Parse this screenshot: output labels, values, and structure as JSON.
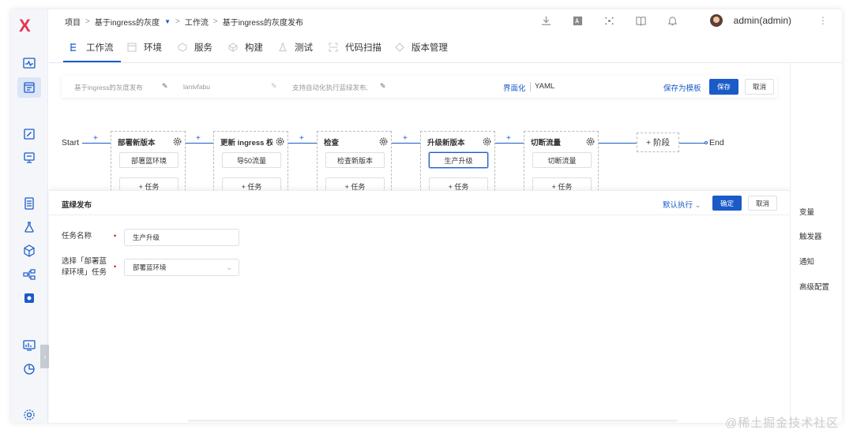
{
  "app": {
    "logo": "X"
  },
  "breadcrumb": [
    "项目",
    "基于ingress的灰度",
    "工作流",
    "基于ingress的灰度发布"
  ],
  "user": {
    "name": "admin(admin)"
  },
  "topbar_icons": [
    "download-icon",
    "translate-icon",
    "plugin-icon",
    "book-icon",
    "bell-icon"
  ],
  "tabs": [
    {
      "label": "工作流",
      "icon": "workflow-icon"
    },
    {
      "label": "环境",
      "icon": "env-icon"
    },
    {
      "label": "服务",
      "icon": "service-icon"
    },
    {
      "label": "构建",
      "icon": "build-icon"
    },
    {
      "label": "测试",
      "icon": "test-icon"
    },
    {
      "label": "代码扫描",
      "icon": "scan-icon"
    },
    {
      "label": "版本管理",
      "icon": "version-icon"
    }
  ],
  "toolbar": {
    "name": "基于ingress的灰度发布",
    "key": "lanivfabu",
    "desc": "支持自动化执行蓝绿发布,",
    "mode_ui": "界面化",
    "mode_yaml": "YAML",
    "save_template": "保存为模板",
    "save": "保存",
    "cancel": "取消"
  },
  "pipeline": {
    "start": "Start",
    "end": "End",
    "plus": "+",
    "add_stage": "+ 阶段",
    "add_task": "+ 任务",
    "stages": [
      {
        "title": "部署新版本",
        "job": "部署蓝环境"
      },
      {
        "title": "更新 ingress 权重",
        "job": "导50流量"
      },
      {
        "title": "检查",
        "job": "检查新版本"
      },
      {
        "title": "升级新版本",
        "job": "生产升级"
      },
      {
        "title": "切断流量",
        "job": "切断流量"
      }
    ]
  },
  "right_panel": [
    "变量",
    "触发器",
    "通知",
    "高级配置"
  ],
  "drawer": {
    "title": "蓝绿发布",
    "exec_mode": "默认执行",
    "confirm": "确定",
    "cancel": "取消",
    "task_name_label": "任务名称",
    "task_name_value": "生产升级",
    "select_label": "选择「部署蓝绿环境」任务",
    "select_value": "部署蓝环境",
    "required_mark": "•"
  },
  "watermark": "@稀土掘金技术社区"
}
